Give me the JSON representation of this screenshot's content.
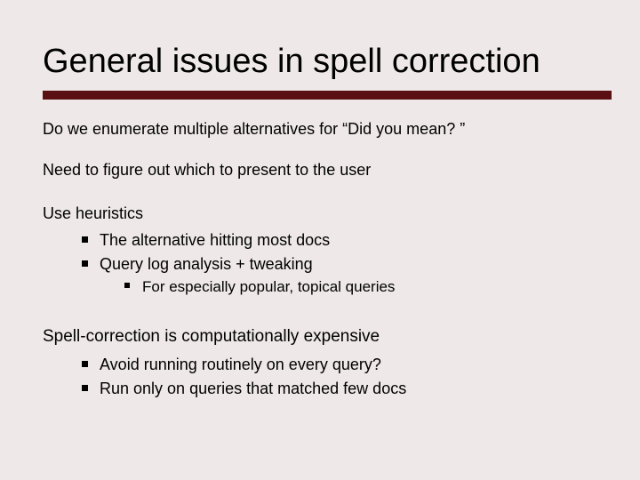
{
  "title": "General issues in spell correction",
  "paragraphs": {
    "p1": "Do we enumerate multiple alternatives for “Did you mean? ”",
    "p2": "Need to figure out which to present to the user",
    "p3": "Use heuristics",
    "p4": "Spell-correction is computationally expensive"
  },
  "heuristics": {
    "b1": "The alternative hitting most docs",
    "b2": "Query log analysis + tweaking",
    "b2sub": "For especially popular, topical queries"
  },
  "cost": {
    "b1": "Avoid running routinely on every query?",
    "b2": "Run only on queries that matched few docs"
  }
}
